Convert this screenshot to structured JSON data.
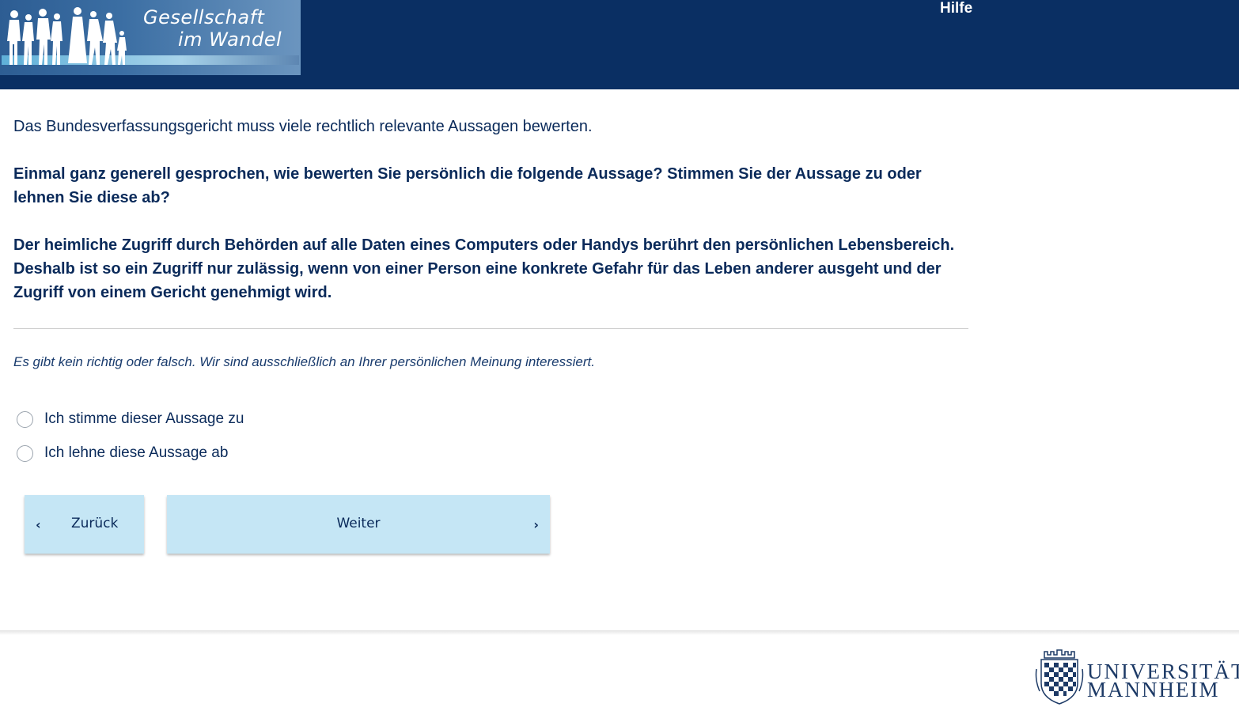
{
  "header": {
    "logo_line1": "Gesellschaft",
    "logo_line2": "im Wandel",
    "help_link": "Hilfe",
    "background_color": "#0a2f63"
  },
  "main": {
    "intro": "Das Bundesverfassungsgericht muss viele rechtlich relevante Aussagen bewerten.",
    "question": "Einmal ganz generell gesprochen, wie bewerten Sie persönlich die folgende Aussage? Stimmen Sie der Aussage zu oder lehnen Sie diese ab?",
    "statement": "Der heimliche Zugriff durch Behörden auf alle Daten eines Computers oder Handys berührt den persönlichen Lebensbereich. Deshalb ist so ein Zugriff nur zulässig, wenn von einer Person eine konkrete Gefahr für das Leben anderer ausgeht und der Zugriff von einem Gericht genehmigt wird.",
    "hint": "Es gibt kein richtig oder falsch. Wir sind ausschließlich an Ihrer persönlichen Meinung interessiert.",
    "options": [
      {
        "label": "Ich stimme dieser Aussage zu",
        "selected": false
      },
      {
        "label": "Ich lehne diese Aussage ab",
        "selected": false
      }
    ]
  },
  "navigation": {
    "back_label": "Zurück",
    "next_label": "Weiter",
    "back_icon": "chevron-left-icon",
    "next_icon": "chevron-right-icon",
    "button_color": "#c5e6f5"
  },
  "footer": {
    "university_line1": "UNIVERSITÄT",
    "university_line2": "MANNHEIM"
  }
}
